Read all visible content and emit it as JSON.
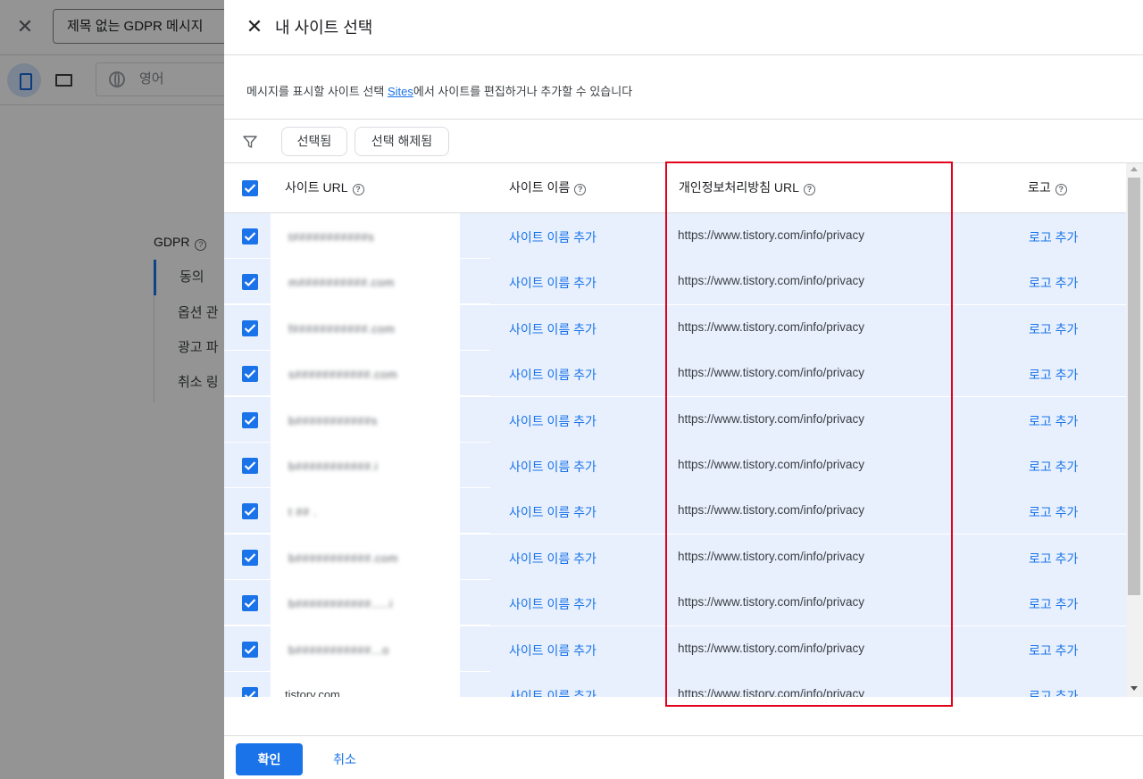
{
  "background": {
    "title_input_value": "제목 없는 GDPR 메시지",
    "language_value": "영어",
    "side_title": "GDPR",
    "side_items": [
      "동의",
      "옵션 관",
      "광고 파",
      "취소 링"
    ]
  },
  "dialog": {
    "title": "내 사이트 선택",
    "description_before": "메시지를 표시할 사이트 선택 ",
    "description_link": "Sites",
    "description_after": "에서 사이트를 편집하거나 추가할 수 있습니다",
    "filter_chips": [
      "선택됨",
      "선택 해제됨"
    ],
    "columns": {
      "url": "사이트 URL",
      "name": "사이트 이름",
      "policy": "개인정보처리방침 URL",
      "logo": "로고"
    },
    "rows": [
      {
        "url": "t###########s",
        "name_action": "사이트 이름 추가",
        "policy": "https://www.tistory.com/info/privacy",
        "logo_action": "로고 추가"
      },
      {
        "url": "m##########.com",
        "name_action": "사이트 이름 추가",
        "policy": "https://www.tistory.com/info/privacy",
        "logo_action": "로고 추가"
      },
      {
        "url": "f###########.com",
        "name_action": "사이트 이름 추가",
        "policy": "https://www.tistory.com/info/privacy",
        "logo_action": "로고 추가"
      },
      {
        "url": "s###########.com",
        "name_action": "사이트 이름 추가",
        "policy": "https://www.tistory.com/info/privacy",
        "logo_action": "로고 추가"
      },
      {
        "url": "b###########s",
        "name_action": "사이트 이름 추가",
        "policy": "https://www.tistory.com/info/privacy",
        "logo_action": "로고 추가"
      },
      {
        "url": "b###########.i",
        "name_action": "사이트 이름 추가",
        "policy": "https://www.tistory.com/info/privacy",
        "logo_action": "로고 추가"
      },
      {
        "url": "t ## .",
        "name_action": "사이트 이름 추가",
        "policy": "https://www.tistory.com/info/privacy",
        "logo_action": "로고 추가"
      },
      {
        "url": "b###########.com",
        "name_action": "사이트 이름 추가",
        "policy": "https://www.tistory.com/info/privacy",
        "logo_action": "로고 추가"
      },
      {
        "url": "b###########.....i",
        "name_action": "사이트 이름 추가",
        "policy": "https://www.tistory.com/info/privacy",
        "logo_action": "로고 추가"
      },
      {
        "url": "b###########...o",
        "name_action": "사이트 이름 추가",
        "policy": "https://www.tistory.com/info/privacy",
        "logo_action": "로고 추가"
      },
      {
        "url": "tistory.com",
        "name_action": "사이트 이름 추가",
        "policy": "https://www.tistory.com/info/privacy",
        "logo_action": "로고 추가"
      }
    ],
    "ok_label": "확인",
    "cancel_label": "취소"
  },
  "colors": {
    "accent": "#1a73e8",
    "row_selected": "#e8f0fe",
    "highlight_box": "#e3001b"
  }
}
